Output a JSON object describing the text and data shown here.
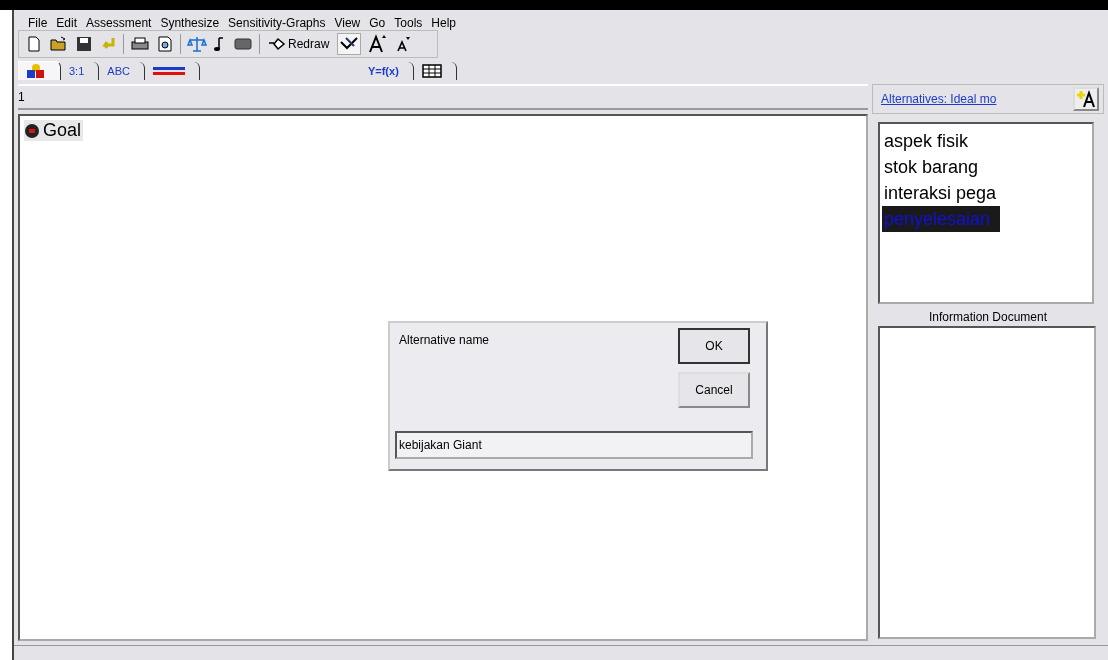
{
  "menu": [
    "File",
    "Edit",
    "Assessment",
    "Synthesize",
    "Sensitivity-Graphs",
    "View",
    "Go",
    "Tools",
    "Help"
  ],
  "toolbar": {
    "redraw_label": "Redraw"
  },
  "tabs": [
    {
      "kind": "shapes",
      "selected": true
    },
    {
      "kind": "text",
      "label": "3:1",
      "selected": false
    },
    {
      "kind": "text",
      "label": "ABC",
      "selected": false
    },
    {
      "kind": "lines",
      "selected": false
    },
    {
      "kind": "formula",
      "label": "Y=f(x)",
      "selected": false
    },
    {
      "kind": "grid",
      "selected": false
    }
  ],
  "level_label": "1",
  "goal": {
    "label": "Goal"
  },
  "alternatives": {
    "title": "Alternatives: Ideal mo",
    "items": [
      {
        "label": "aspek fisik",
        "selected": false
      },
      {
        "label": "stok barang",
        "selected": false
      },
      {
        "label": "interaksi pega",
        "selected": false
      },
      {
        "label": "penyelesaian",
        "selected": true
      }
    ]
  },
  "information_document": {
    "title": "Information Document"
  },
  "dialog": {
    "label": "Alternative name",
    "ok": "OK",
    "cancel": "Cancel",
    "value": "kebijakan Giant"
  }
}
